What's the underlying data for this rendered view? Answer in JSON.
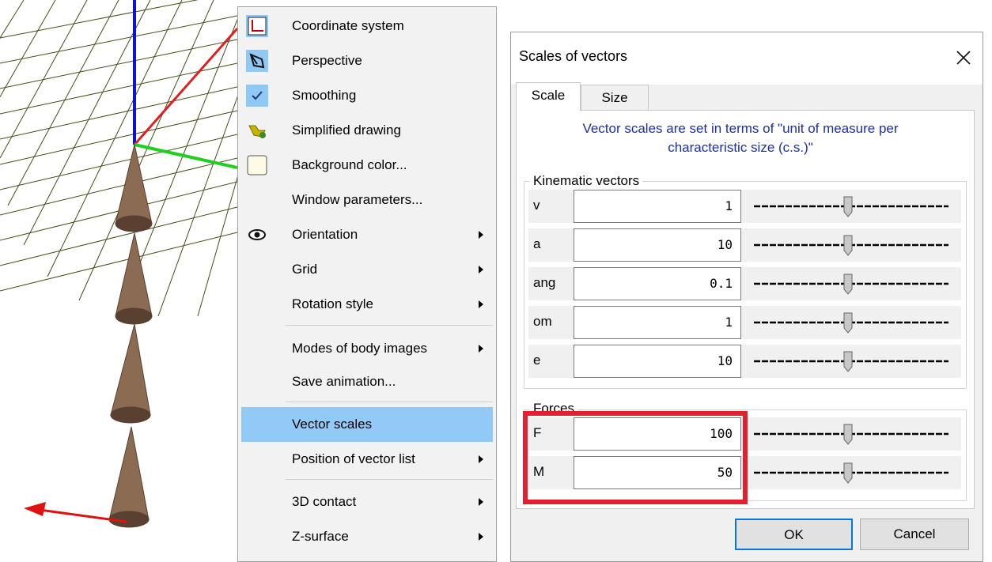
{
  "menu": {
    "items": [
      {
        "label": "Coordinate system",
        "icon": "coordinate-system-icon",
        "checked": true,
        "submenu": false
      },
      {
        "label": "Perspective",
        "icon": "perspective-icon",
        "checked": true,
        "submenu": false
      },
      {
        "label": "Smoothing",
        "icon": "check-icon",
        "checked": true,
        "submenu": false
      },
      {
        "label": "Simplified drawing",
        "icon": "simplified-drawing-icon",
        "checked": false,
        "submenu": false
      },
      {
        "label": "Background color...",
        "icon": "background-color-icon",
        "checked": false,
        "submenu": false
      },
      {
        "label": "Window parameters...",
        "icon": "",
        "checked": false,
        "submenu": false
      },
      {
        "label": "Orientation",
        "icon": "eye-icon",
        "checked": false,
        "submenu": true
      },
      {
        "label": "Grid",
        "icon": "",
        "checked": false,
        "submenu": true
      },
      {
        "label": "Rotation style",
        "icon": "",
        "checked": false,
        "submenu": true
      },
      {
        "label": "Modes of body images",
        "icon": "",
        "checked": false,
        "submenu": true
      },
      {
        "label": "Save animation...",
        "icon": "",
        "checked": false,
        "submenu": false
      },
      {
        "label": "Vector scales",
        "icon": "",
        "checked": false,
        "submenu": false,
        "highlighted": true
      },
      {
        "label": "Position of vector list",
        "icon": "",
        "checked": false,
        "submenu": true
      },
      {
        "label": "3D contact",
        "icon": "",
        "checked": false,
        "submenu": true
      },
      {
        "label": "Z-surface",
        "icon": "",
        "checked": false,
        "submenu": true
      }
    ]
  },
  "dialog": {
    "title": "Scales of vectors",
    "tabs": [
      "Scale",
      "Size"
    ],
    "active_tab": "Scale",
    "note_line1": "Vector scales are set in terms of \"unit of measure per",
    "note_line2": "characteristic size (c.s.)\"",
    "kinematic": {
      "label": "Kinematic vectors",
      "rows": [
        {
          "label": "v",
          "value": "1"
        },
        {
          "label": "a",
          "value": "10"
        },
        {
          "label": "ang",
          "value": "0.1"
        },
        {
          "label": "om",
          "value": "1"
        },
        {
          "label": "e",
          "value": "10"
        }
      ]
    },
    "forces": {
      "label": "Forces",
      "rows": [
        {
          "label": "F",
          "value": "100"
        },
        {
          "label": "M",
          "value": "50"
        }
      ]
    },
    "ok": "OK",
    "cancel": "Cancel"
  },
  "colors": {
    "highlight": "#91c9f7",
    "annotation_box": "#e3202e",
    "note_text": "#1a2fa8",
    "grid": "#4a4a1a",
    "cone": "#8b6b52"
  }
}
